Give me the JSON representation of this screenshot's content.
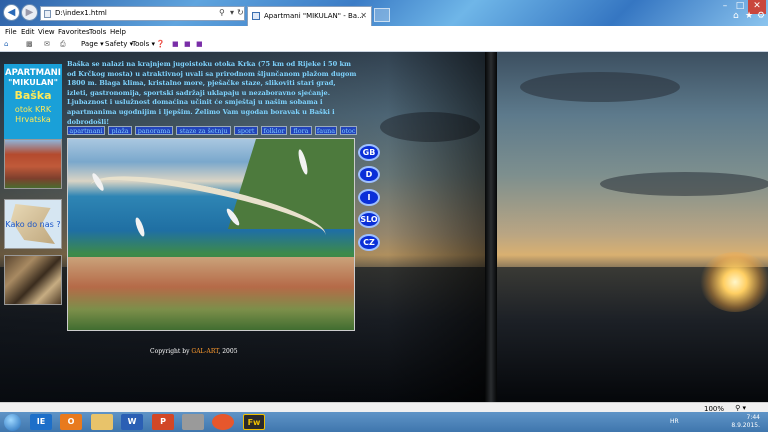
{
  "browser": {
    "address": "D:\\index1.html",
    "tab_title": "Apartmani \"MIKULAN\" - Ba...",
    "menu": [
      "File",
      "Edit",
      "View",
      "Favorites",
      "Tools",
      "Help"
    ],
    "commands": [
      "Page ▾",
      "Safety ▾",
      "Tools ▾"
    ]
  },
  "page": {
    "logo": {
      "line1": "APARTMANI",
      "line2": "\"MIKULAN\"",
      "line3": "Baška",
      "line4": "otok KRK",
      "line5": "Hrvatska"
    },
    "intro_text": "Baška se nalazi na krajnjem jugoistoku otoka Krka (75 km od Rijeke i 50 km od Krčkog mosta) u atraktivnoj uvali sa prirodnom šljunčanom plažom dugom 1800 m. Blaga klima, kristalno more, pješačke staze, slikoviti stari grad, izleti, gastronomija, sportski sadržaji uklapaju u nezaboravno sjećanje. Ljubaznost i uslužnost domaćina učinit će smještaj u našim sobama i apartmanima ugodnijim i ljepšim. Želimo Vam ugodan boravak u Baški i dobrodošli!",
    "nav": [
      "apartmani",
      "plaža",
      "panorama",
      "staze za šetnju",
      "sport",
      "folklor",
      "flora",
      "fauna",
      "otoc"
    ],
    "kako_do_nas": "Kako do nas ?",
    "languages": [
      "GB",
      "D",
      "I",
      "SLO",
      "CZ"
    ],
    "copyright_prefix": "Copyright by",
    "copyright_author": "GAL-ART",
    "copyright_year": ", 2005"
  },
  "status": {
    "zoom": "100%"
  },
  "taskbar": {
    "apps": [
      "IE",
      "O",
      "",
      "W",
      "P",
      "",
      "",
      "Fw"
    ],
    "lang": "HR",
    "time": "7:44",
    "date": "8.9.2015."
  }
}
